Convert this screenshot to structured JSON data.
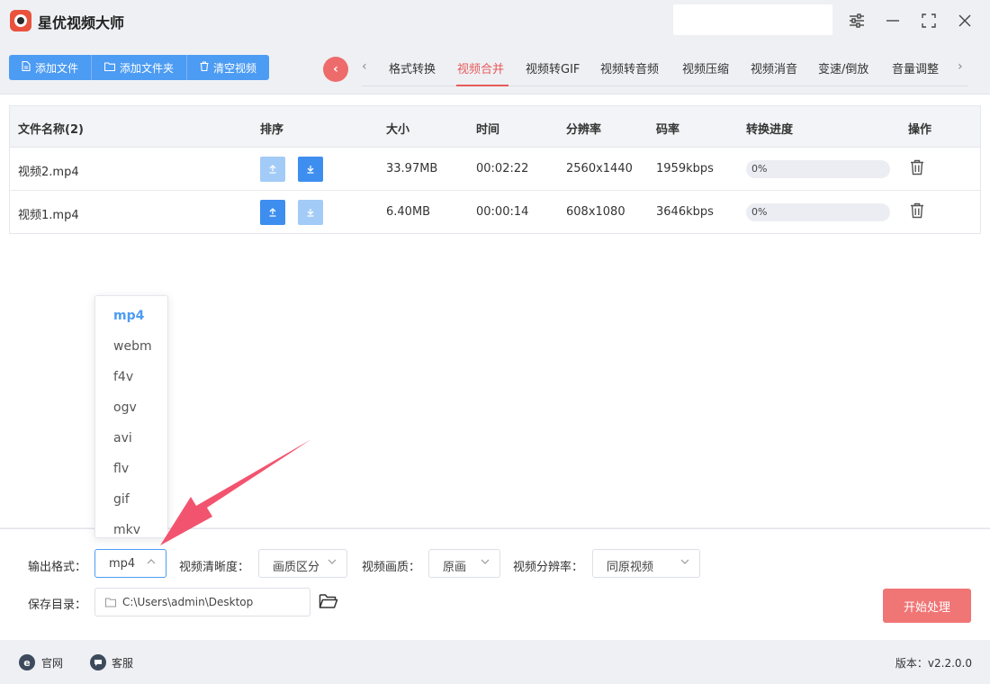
{
  "app": {
    "title": "星优视频大师"
  },
  "toolbar": {
    "add_file": "添加文件",
    "add_folder": "添加文件夹",
    "clear_videos": "清空视频",
    "tabs": [
      "格式转换",
      "视频合并",
      "视频转GIF",
      "视频转音频",
      "视频压缩",
      "视频消音",
      "变速/倒放",
      "音量调整"
    ],
    "active_tab": "视频合并"
  },
  "table": {
    "headers": {
      "name": "文件名称(2)",
      "sort": "排序",
      "size": "大小",
      "time": "时间",
      "resolution": "分辨率",
      "bitrate": "码率",
      "progress": "转换进度",
      "action": "操作"
    },
    "rows": [
      {
        "name": "视频2.mp4",
        "size": "33.97MB",
        "time": "00:02:22",
        "resolution": "2560x1440",
        "bitrate": "1959kbps",
        "progress": "0%"
      },
      {
        "name": "视频1.mp4",
        "size": "6.40MB",
        "time": "00:00:14",
        "resolution": "608x1080",
        "bitrate": "3646kbps",
        "progress": "0%"
      }
    ]
  },
  "dropdown": {
    "options": [
      "mp4",
      "webm",
      "f4v",
      "ogv",
      "avi",
      "flv",
      "gif",
      "mkv"
    ],
    "selected": "mp4"
  },
  "settings": {
    "output_format_label": "输出格式：",
    "output_format_value": "mp4",
    "clarity_label": "视频清晰度：",
    "clarity_value": "画质区分",
    "quality_label": "视频画质：",
    "quality_value": "原画",
    "resolution_label": "视频分辨率：",
    "resolution_value": "同原视频",
    "save_dir_label": "保存目录：",
    "save_dir_value": "C:\\Users\\admin\\Desktop",
    "start_button": "开始处理"
  },
  "statusbar": {
    "website": "官网",
    "service": "客服",
    "version": "版本：v2.2.0.0"
  },
  "colors": {
    "accent_blue": "#4d9cf3",
    "accent_red": "#f07575",
    "active_tab": "#e85a5a"
  }
}
